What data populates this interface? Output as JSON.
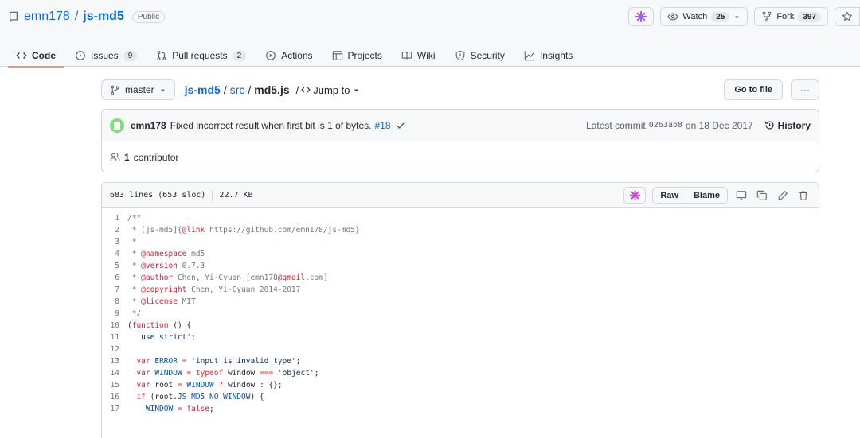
{
  "repo": {
    "owner": "emn178",
    "separator": "/",
    "name": "js-md5",
    "visibility": "Public"
  },
  "actions": {
    "watch_label": "Watch",
    "watch_count": "25",
    "fork_label": "Fork",
    "fork_count": "397"
  },
  "tabs": [
    {
      "label": "Code",
      "count": ""
    },
    {
      "label": "Issues",
      "count": "9"
    },
    {
      "label": "Pull requests",
      "count": "2"
    },
    {
      "label": "Actions",
      "count": ""
    },
    {
      "label": "Projects",
      "count": ""
    },
    {
      "label": "Wiki",
      "count": ""
    },
    {
      "label": "Security",
      "count": ""
    },
    {
      "label": "Insights",
      "count": ""
    }
  ],
  "filenav": {
    "branch": "master",
    "repo_crumb": "js-md5",
    "dir_crumb": "src",
    "file_crumb": "md5.js",
    "slash": "/",
    "jump_to": "Jump to",
    "go_to_file": "Go to file",
    "more": "···"
  },
  "commit": {
    "author": "emn178",
    "message": "Fixed incorrect result when first bit is 1 of bytes.",
    "ref": "#18",
    "latest_label": "Latest commit",
    "sha": "0263ab8",
    "date": "on 18 Dec 2017",
    "history_label": "History"
  },
  "contributors": {
    "count": "1",
    "label": "contributor"
  },
  "file_info": {
    "lines": "683 lines (653 sloc)",
    "size": "22.7 KB",
    "raw_label": "Raw",
    "blame_label": "Blame"
  },
  "code_lines": [
    {
      "n": "1",
      "text": "/**"
    },
    {
      "n": "2",
      "text": " * [js-md5]{@link https://github.com/emn178/js-md5}"
    },
    {
      "n": "3",
      "text": " *"
    },
    {
      "n": "4",
      "text": " * @namespace md5"
    },
    {
      "n": "5",
      "text": " * @version 0.7.3"
    },
    {
      "n": "6",
      "text": " * @author Chen, Yi-Cyuan [emn178@gmail.com]"
    },
    {
      "n": "7",
      "text": " * @copyright Chen, Yi-Cyuan 2014-2017"
    },
    {
      "n": "8",
      "text": " * @license MIT"
    },
    {
      "n": "9",
      "text": " */"
    },
    {
      "n": "10",
      "text": "(function () {"
    },
    {
      "n": "11",
      "text": "  'use strict';"
    },
    {
      "n": "12",
      "text": ""
    },
    {
      "n": "13",
      "text": "  var ERROR = 'input is invalid type';"
    },
    {
      "n": "14",
      "text": "  var WINDOW = typeof window === 'object';"
    },
    {
      "n": "15",
      "text": "  var root = WINDOW ? window : {};"
    },
    {
      "n": "16",
      "text": "  if (root.JS_MD5_NO_WINDOW) {"
    },
    {
      "n": "17",
      "text": "    WINDOW = false;"
    }
  ]
}
